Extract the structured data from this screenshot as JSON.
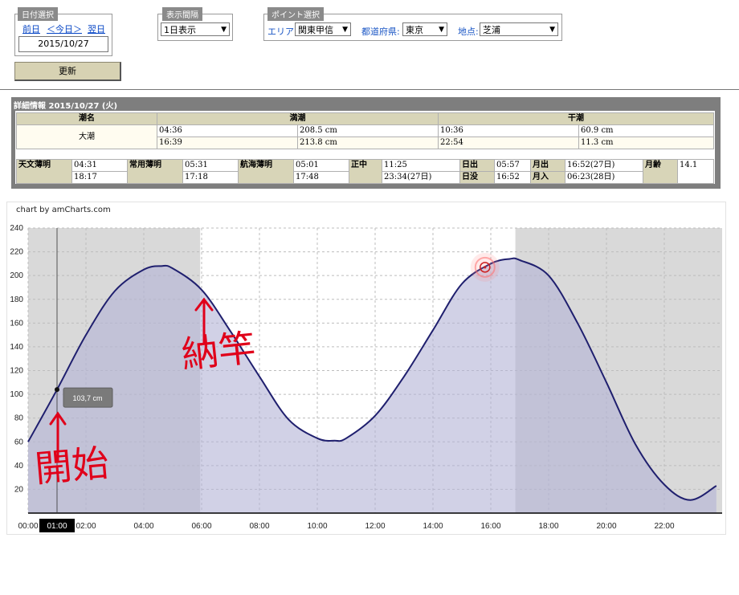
{
  "date_panel": {
    "legend": "日付選択",
    "prev": "前日",
    "today": "＜今日＞",
    "next": "翌日",
    "date": "2015/10/27"
  },
  "interval_panel": {
    "legend": "表示間隔",
    "selected": "1日表示"
  },
  "point_panel": {
    "legend": "ポイント選択",
    "area_label": "エリア:",
    "area_value": "関東甲信",
    "pref_label": "都道府県:",
    "pref_value": "東京",
    "spot_label": "地点:",
    "spot_value": "芝浦"
  },
  "update_button": "更新",
  "detail": {
    "header": "詳細情報 2015/10/27 (火)",
    "col_name": "潮名",
    "col_high": "満潮",
    "col_low": "干潮",
    "tide_name": "大潮",
    "high": [
      {
        "time": "04:36",
        "height": "208.5 cm"
      },
      {
        "time": "16:39",
        "height": "213.8 cm"
      }
    ],
    "low": [
      {
        "time": "10:36",
        "height": "60.9 cm"
      },
      {
        "time": "22:54",
        "height": "11.3 cm"
      }
    ],
    "astro": {
      "astro_twilight_label": "天文薄明",
      "astro_twilight": [
        "04:31",
        "18:17"
      ],
      "civil_twilight_label": "常用薄明",
      "civil_twilight": [
        "05:31",
        "17:18"
      ],
      "nautical_twilight_label": "航海薄明",
      "nautical_twilight": [
        "05:01",
        "17:48"
      ],
      "meridian_label": "正中",
      "meridian": [
        "11:25",
        "23:34(27日)"
      ],
      "sunrise_label": "日出",
      "sunrise": "05:57",
      "sunset_label": "日没",
      "sunset": "16:52",
      "moonrise_label": "月出",
      "moonrise": "16:52(27日)",
      "moonset_label": "月入",
      "moonset": "06:23(28日)",
      "moon_age_label": "月齢",
      "moon_age": "14.1"
    }
  },
  "chart_data": {
    "type": "area",
    "credit": "chart by amCharts.com",
    "x_ticks": [
      "00:00",
      "02:00",
      "04:00",
      "06:00",
      "08:00",
      "10:00",
      "12:00",
      "14:00",
      "16:00",
      "18:00",
      "20:00",
      "22:00"
    ],
    "y_ticks": [
      20,
      40,
      60,
      80,
      100,
      120,
      140,
      160,
      180,
      200,
      220,
      240
    ],
    "ylim": [
      0,
      240
    ],
    "xlim_hours": [
      0,
      24
    ],
    "x_hours": [
      0,
      1,
      2,
      3,
      4,
      4.6,
      5,
      6,
      7,
      8,
      9,
      10,
      10.6,
      11,
      12,
      13,
      14,
      15,
      16,
      16.65,
      17,
      18,
      19,
      20,
      21,
      22,
      22.9,
      23.8
    ],
    "y_values": [
      60,
      104,
      150,
      187,
      205,
      208,
      206,
      188,
      153,
      115,
      79,
      63,
      61,
      63,
      82,
      115,
      154,
      193,
      210,
      214,
      213,
      200,
      160,
      110,
      58,
      24,
      11,
      23
    ],
    "night_bands_hours": [
      [
        0,
        5.95
      ],
      [
        16.85,
        24
      ]
    ],
    "cursor": {
      "time": "01:00",
      "value_label": "103,7 cm"
    },
    "grid": true,
    "colors": {
      "line": "#1f1f6e",
      "fill": "#b3b3d6",
      "night": "#d9d9d9"
    },
    "annotations": [
      "開始",
      "納竿"
    ]
  }
}
